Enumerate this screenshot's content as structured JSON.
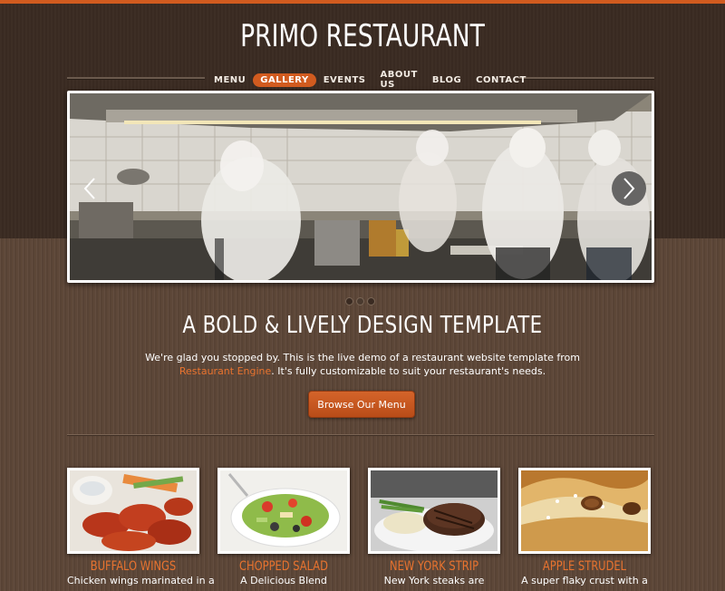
{
  "site": {
    "title": "PRIMO RESTAURANT"
  },
  "nav": {
    "items": [
      {
        "label": "MENU"
      },
      {
        "label": "GALLERY",
        "active": true
      },
      {
        "label": "EVENTS"
      },
      {
        "label": "ABOUT US"
      },
      {
        "label": "BLOG"
      },
      {
        "label": "CONTACT"
      }
    ]
  },
  "slider": {
    "dot_count": 3,
    "active_dot": 1
  },
  "hero": {
    "tagline": "A BOLD & LIVELY DESIGN TEMPLATE",
    "intro_part1": "We're glad you stopped by.  This is the live demo of a restaurant website template from",
    "intro_link": "Restaurant Engine",
    "intro_part2": ".  It's fully customizable to suit your restaurant's needs.",
    "cta_label": "Browse Our Menu"
  },
  "features": [
    {
      "name": "BUFFALO WINGS",
      "desc": "Chicken wings marinated in a"
    },
    {
      "name": "CHOPPED SALAD",
      "desc": "A Delicious Blend"
    },
    {
      "name": "NEW YORK STRIP",
      "desc": "New York steaks are"
    },
    {
      "name": "APPLE STRUDEL",
      "desc": "A super flaky crust with a"
    }
  ],
  "colors": {
    "accent": "#d15b1f",
    "link": "#e8732f",
    "header_bg": "#3a2b22",
    "body_bg": "#5d4738"
  }
}
